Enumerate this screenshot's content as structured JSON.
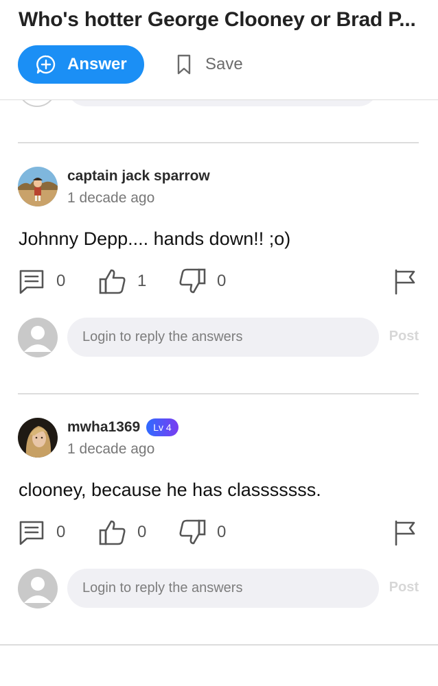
{
  "question": {
    "title": "Who's hotter George Clooney or Brad P...",
    "answer_label": "Answer",
    "save_label": "Save"
  },
  "colors": {
    "accent": "#1b8ff5",
    "divider": "#dcdcdc",
    "badge_start": "#2f6bff",
    "badge_end": "#7a3cf0"
  },
  "answers": [
    {
      "username": "captain jack sparrow",
      "time": "1 decade ago",
      "text": "Johnny Depp.... hands down!! ;o)",
      "comments": "0",
      "likes": "1",
      "dislikes": "0",
      "reply_placeholder": "Login to reply the answers",
      "post_label": "Post"
    },
    {
      "username": "mwha1369",
      "level": "Lv 4",
      "time": "1 decade ago",
      "text": "clooney, because he has classsssss.",
      "comments": "0",
      "likes": "0",
      "dislikes": "0",
      "reply_placeholder": "Login to reply the answers",
      "post_label": "Post"
    }
  ]
}
